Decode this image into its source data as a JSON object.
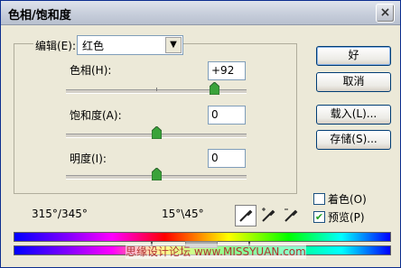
{
  "window": {
    "title": "色相/饱和度",
    "close_glyph": "×"
  },
  "edit": {
    "label": "编辑(E):",
    "selected": "红色"
  },
  "hue": {
    "label": "色相(H):",
    "value": "+92"
  },
  "saturation": {
    "label": "饱和度(A):",
    "value": "0"
  },
  "lightness": {
    "label": "明度(I):",
    "value": "0"
  },
  "buttons": {
    "ok": "好",
    "cancel": "取消",
    "load": "载入(L)...",
    "save": "存储(S)..."
  },
  "options": {
    "colorize": "着色(O)",
    "colorize_checked": false,
    "preview": "预览(P)",
    "preview_checked": true
  },
  "range": {
    "left": "315°/345°",
    "right": "15°\\45°"
  },
  "eyedroppers": [
    "eyedropper-icon",
    "eyedropper-plus-icon",
    "eyedropper-minus-icon"
  ],
  "watermark": "思缘设计论坛 www.MISSYUAN.com"
}
